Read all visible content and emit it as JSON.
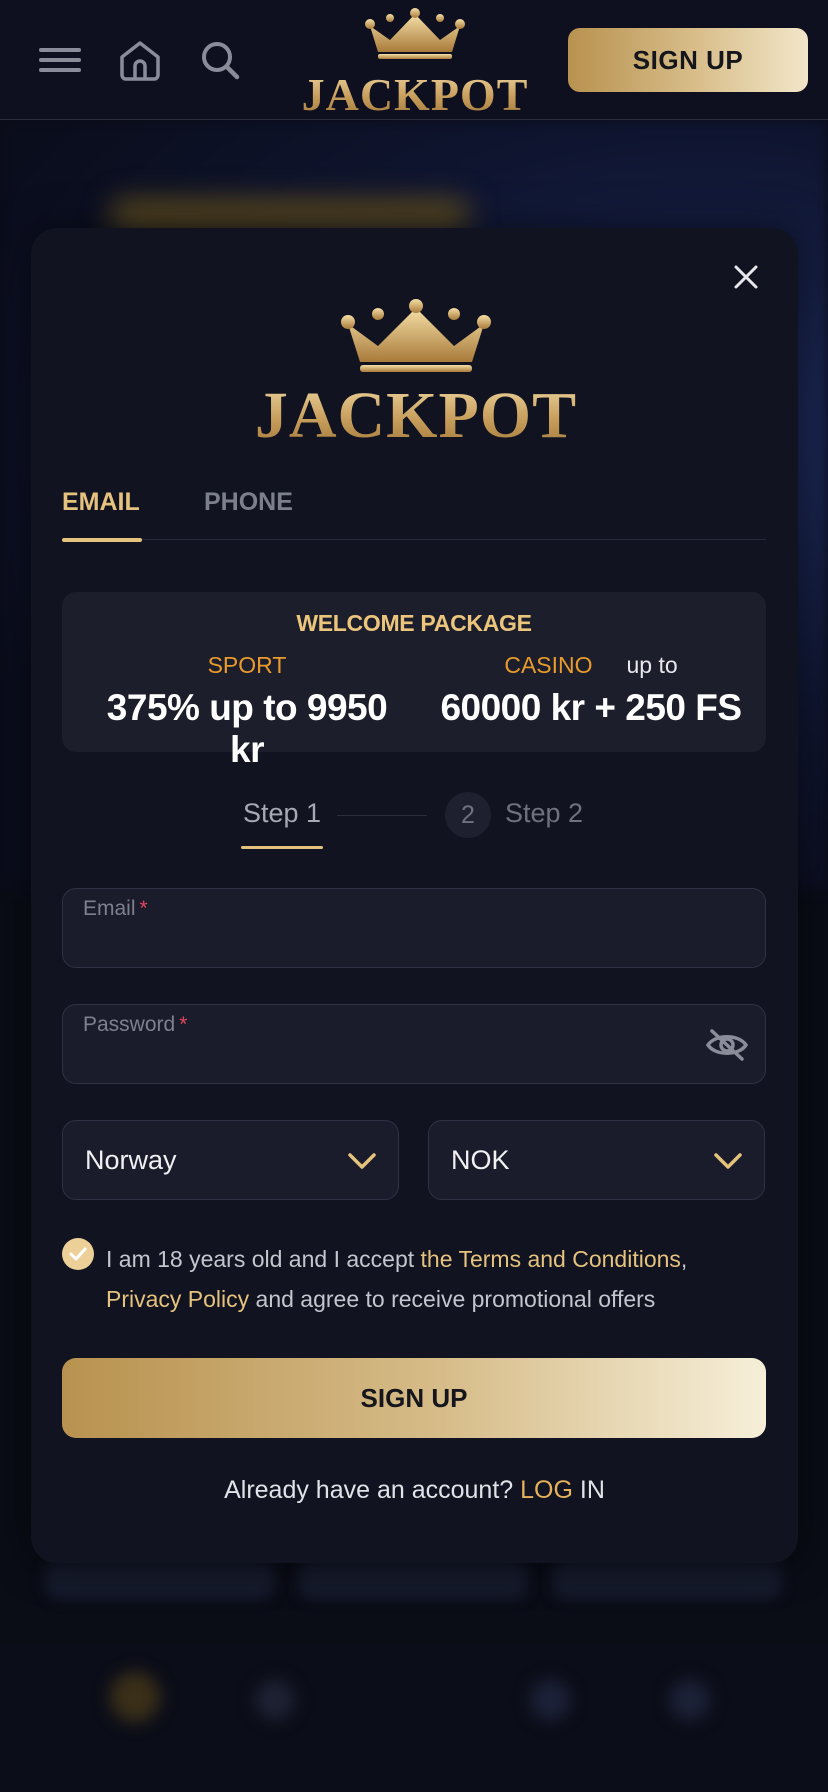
{
  "header": {
    "menu_icon": "hamburger-menu-icon",
    "home_icon": "home-icon",
    "search_icon": "search-icon",
    "logo_text": "JACKPOT",
    "signup_label": "SIGN UP"
  },
  "modal": {
    "close_icon": "close-icon",
    "logo_text": "JACKPOT",
    "tabs": [
      {
        "label": "EMAIL",
        "active": true
      },
      {
        "label": "PHONE",
        "active": false
      }
    ],
    "welcome": {
      "title": "WELCOME PACKAGE",
      "sport_label": "SPORT",
      "sport_value": "375% up to 9950 kr",
      "casino_label": "CASINO",
      "casino_upto": "up to",
      "casino_value": "60000 kr + 250 FS"
    },
    "steps": {
      "step1_label": "Step 1",
      "step2_number": "2",
      "step2_label": "Step 2"
    },
    "form": {
      "email_label": "Email",
      "email_value": "",
      "password_label": "Password",
      "password_value": "",
      "required_mark": "*",
      "country_value": "Norway",
      "currency_value": "NOK"
    },
    "consent": {
      "checked": true,
      "text_part1": "I am 18 years old and I accept ",
      "terms_link": "the Terms and Conditions",
      "comma": ",",
      "privacy_link": "Privacy Policy",
      "text_part2": " and agree to receive promotional offers"
    },
    "signup_label": "SIGN UP",
    "login_prompt": "Already have an account? ",
    "login_link_part1": "LOG",
    "login_link_part2": " IN"
  },
  "colors": {
    "accent_gold": "#e5c27e",
    "sport_orange": "#e89b2c",
    "required_red": "#e0475b",
    "modal_bg": "#111320"
  }
}
